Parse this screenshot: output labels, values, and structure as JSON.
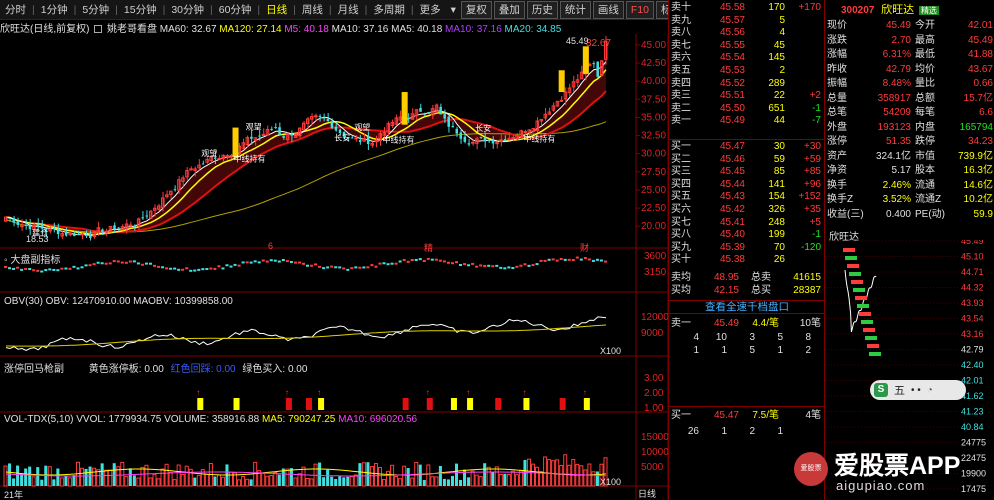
{
  "toolbar": {
    "periods": [
      "分时",
      "1分钟",
      "5分钟",
      "15分钟",
      "30分钟",
      "60分钟",
      "日线",
      "周线",
      "月线",
      "多周期",
      "更多"
    ],
    "active_period": "日线",
    "right_buttons": [
      "复权",
      "叠加",
      "历史",
      "统计",
      "画线",
      "F10",
      "标记",
      "自选",
      "返回"
    ]
  },
  "info_line": {
    "name": "欣旺达(日线,前复权)",
    "indicator": "姚老哥看盘",
    "ma60": "MA60: 32.67",
    "ma120": "MA120: 27.14",
    "m5": "M5: 40.18",
    "m10": "MA10: 37.16",
    "ma5b": "MA5: 40.18",
    "ma10b": "MA10: 37.16",
    "ma20": "MA20: 34.85"
  },
  "main_chart": {
    "y_ticks": [
      "45.00",
      "42.50",
      "40.00",
      "37.50",
      "35.00",
      "32.50",
      "30.00",
      "27.50",
      "25.00",
      "22.50",
      "20.00"
    ],
    "high_label": "45.49",
    "low_label": "18.53",
    "top_right_value": "32.67",
    "markers": [
      "6",
      "精",
      "财"
    ],
    "annotation_labels": [
      "建仓",
      "观望",
      "中线持有",
      "观望",
      "长安",
      "观望",
      "中线持有",
      "长安",
      "中线持有"
    ]
  },
  "panel_dapan": {
    "label": "大盘副指标",
    "y_ticks": [
      "3600",
      "3150"
    ]
  },
  "panel_obv": {
    "label": "OBV(30) OBV: 12470910.00 MAOBV: 10399858.00",
    "y_ticks": [
      "12000",
      "9000"
    ],
    "unit": "X100"
  },
  "panel_zhangting": {
    "label": "涨停回马枪副",
    "yellow": "黄色涨停板: 0.00",
    "blue": "红色回踩: 0.00",
    "green": "绿色买入: 0.00",
    "y_ticks": [
      "3.00",
      "2.00",
      "1.00"
    ]
  },
  "panel_vol": {
    "label": "VOL-TDX(5,10)",
    "vvol": "VVOL: 1779934.75",
    "volume": "VOLUME: 358916.88",
    "ma5": "MA5: 790247.25",
    "ma10": "MA10: 696020.56",
    "y_ticks": [
      "15000",
      "10000",
      "5000"
    ],
    "unit": "X100"
  },
  "bottom_axis": {
    "year": "21年",
    "right": "日线"
  },
  "orderbook": {
    "asks": [
      {
        "label": "卖十",
        "price": "45.58",
        "vol": "170",
        "chg": "+170"
      },
      {
        "label": "卖九",
        "price": "45.57",
        "vol": "5",
        "chg": ""
      },
      {
        "label": "卖八",
        "price": "45.56",
        "vol": "4",
        "chg": ""
      },
      {
        "label": "卖七",
        "price": "45.55",
        "vol": "45",
        "chg": ""
      },
      {
        "label": "卖六",
        "price": "45.54",
        "vol": "145",
        "chg": ""
      },
      {
        "label": "卖五",
        "price": "45.53",
        "vol": "2",
        "chg": ""
      },
      {
        "label": "卖四",
        "price": "45.52",
        "vol": "289",
        "chg": ""
      },
      {
        "label": "卖三",
        "price": "45.51",
        "vol": "22",
        "chg": "+2"
      },
      {
        "label": "卖二",
        "price": "45.50",
        "vol": "651",
        "chg": "-1"
      },
      {
        "label": "卖一",
        "price": "45.49",
        "vol": "44",
        "chg": "-7"
      }
    ],
    "bids": [
      {
        "label": "买一",
        "price": "45.47",
        "vol": "30",
        "chg": "+30"
      },
      {
        "label": "买二",
        "price": "45.46",
        "vol": "59",
        "chg": "+59"
      },
      {
        "label": "买三",
        "price": "45.45",
        "vol": "85",
        "chg": "+85"
      },
      {
        "label": "买四",
        "price": "45.44",
        "vol": "141",
        "chg": "+96"
      },
      {
        "label": "买五",
        "price": "45.43",
        "vol": "154",
        "chg": "+152"
      },
      {
        "label": "买六",
        "price": "45.42",
        "vol": "326",
        "chg": "+35"
      },
      {
        "label": "买七",
        "price": "45.41",
        "vol": "248",
        "chg": "+5"
      },
      {
        "label": "买八",
        "price": "45.40",
        "vol": "199",
        "chg": "-1"
      },
      {
        "label": "买九",
        "price": "45.39",
        "vol": "70",
        "chg": "-120"
      },
      {
        "label": "买十",
        "price": "45.38",
        "vol": "26",
        "chg": ""
      }
    ],
    "sell_avg": {
      "label": "卖均",
      "price": "48.95",
      "total_label": "总卖",
      "total": "41615"
    },
    "buy_avg": {
      "label": "买均",
      "price": "42.15",
      "total_label": "总买",
      "total": "28387"
    },
    "link": "查看全速千档盘口",
    "sell1": {
      "label": "卖一",
      "price": "45.49",
      "qty": "4.4/笔",
      "count": "10笔"
    },
    "sell1_queue": [
      "4",
      "10",
      "3",
      "5",
      "8",
      "1",
      "1",
      "5",
      "1",
      "2",
      "1"
    ],
    "buy1": {
      "label": "买一",
      "price": "45.47",
      "qty": "7.5/笔",
      "count": "4笔"
    },
    "buy1_queue": [
      "26",
      "1",
      "2",
      "1"
    ]
  },
  "quote": {
    "code": "300207",
    "name": "欣旺达",
    "badge": "精选",
    "rows": [
      {
        "l1": "现价",
        "v1": "45.49",
        "l2": "今开",
        "v2": "42.01"
      },
      {
        "l1": "涨跌",
        "v1": "2.70",
        "l2": "最高",
        "v2": "45.49"
      },
      {
        "l1": "涨幅",
        "v1": "6.31%",
        "l2": "最低",
        "v2": "41.88"
      },
      {
        "l1": "昨收",
        "v1": "42.79",
        "l2": "均价",
        "v2": "43.67"
      },
      {
        "l1": "振幅",
        "v1": "8.48%",
        "l2": "量比",
        "v2": "0.66"
      },
      {
        "l1": "总量",
        "v1": "358917",
        "l2": "总额",
        "v2": "15.7亿"
      },
      {
        "l1": "总笔",
        "v1": "54209",
        "l2": "每笔",
        "v2": "6.6"
      },
      {
        "l1": "外盘",
        "v1": "193123",
        "l2": "内盘",
        "v2": "165794"
      },
      {
        "l1": "涨停",
        "v1": "51.35",
        "l2": "跌停",
        "v2": "34.23"
      },
      {
        "l1": "资产",
        "v1": "324.1亿",
        "l2": "市值",
        "v2": "739.9亿"
      },
      {
        "l1": "净资",
        "v1": "5.17",
        "l2": "股本",
        "v2": "16.3亿"
      },
      {
        "l1": "换手",
        "v1": "2.46%",
        "l2": "流通",
        "v2": "14.6亿"
      },
      {
        "l1": "换手Z",
        "v1": "3.52%",
        "l2": "流通Z",
        "v2": "10.2亿"
      },
      {
        "l1": "收益(三)",
        "v1": "0.400",
        "l2": "PE(动)",
        "v2": "59.9"
      }
    ],
    "mini_title": "欣旺达",
    "mini_ticks": [
      "45.49",
      "45.10",
      "44.71",
      "44.32",
      "43.93",
      "43.54",
      "43.16",
      "42.79",
      "42.40",
      "42.01",
      "41.62",
      "41.23",
      "40.84",
      "24775",
      "22475",
      "19900",
      "17475"
    ]
  },
  "float_widget": {
    "letter": "S",
    "text": "五"
  },
  "watermark": {
    "brand": "爱股票APP",
    "url": "aigupiao.com"
  },
  "colors": {
    "up": "#ff3b3b",
    "down": "#40e0e0",
    "grid": "#800000",
    "ma_yellow": "#ffff00",
    "ma_red": "#e01010"
  }
}
